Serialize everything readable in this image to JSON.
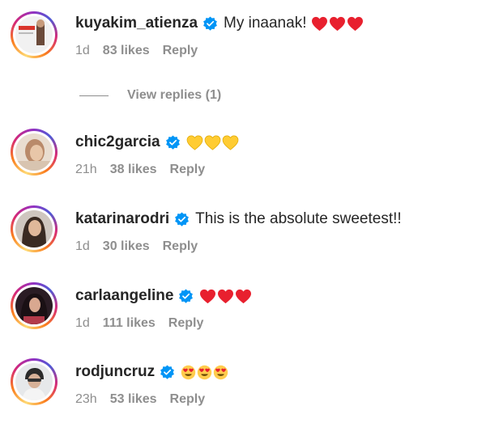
{
  "comments": [
    {
      "username": "kuyakim_atienza",
      "verified": true,
      "text": "My inaanak!",
      "emoji": [
        "red-heart",
        "red-heart",
        "red-heart"
      ],
      "time": "1d",
      "likes": "83 likes",
      "reply": "Reply"
    },
    {
      "username": "chic2garcia",
      "verified": true,
      "text": "",
      "emoji": [
        "yellow-heart",
        "yellow-heart",
        "yellow-heart"
      ],
      "time": "21h",
      "likes": "38 likes",
      "reply": "Reply"
    },
    {
      "username": "katarinarodri",
      "verified": true,
      "text": "This is the absolute sweetest!!",
      "emoji": [],
      "time": "1d",
      "likes": "30 likes",
      "reply": "Reply"
    },
    {
      "username": "carlaangeline",
      "verified": true,
      "text": "",
      "emoji": [
        "red-heart",
        "red-heart",
        "red-heart"
      ],
      "time": "1d",
      "likes": "111 likes",
      "reply": "Reply"
    },
    {
      "username": "rodjuncruz",
      "verified": true,
      "text": "",
      "emoji": [
        "heart-eyes-face",
        "heart-eyes-face",
        "heart-eyes-face"
      ],
      "time": "23h",
      "likes": "53 likes",
      "reply": "Reply"
    }
  ],
  "view_replies": {
    "label": "View replies (1)"
  },
  "colors": {
    "primary_text": "#262626",
    "secondary_text": "#8e8e8e",
    "verified_badge": "#0095f6",
    "red_heart": "#e8202e",
    "yellow_heart": "#ffcc33"
  }
}
